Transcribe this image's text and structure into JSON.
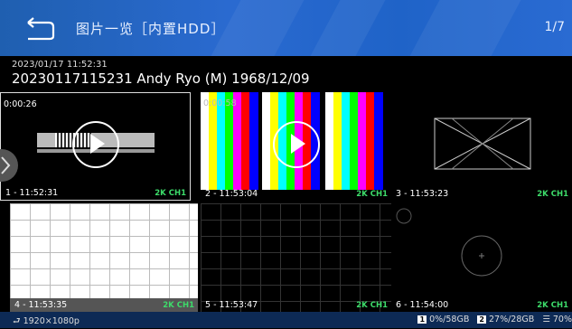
{
  "header": {
    "title": "图片一览［内置HDD］",
    "page_indicator": "1/7"
  },
  "record": {
    "datetime": "2023/01/17 11:52:31",
    "name": "20230117115231 Andy Ryo (M) 1968/12/09"
  },
  "thumbnails": [
    {
      "duration": "0:00:26",
      "caption": "1 - 11:52:31",
      "tag": "2K CH1"
    },
    {
      "duration": "0:00:58",
      "caption": "2 - 11:53:04",
      "tag": "2K CH1"
    },
    {
      "duration": "",
      "caption": "3 - 11:53:23",
      "tag": "2K CH1"
    },
    {
      "duration": "",
      "caption": "4 - 11:53:35",
      "tag": "2K CH1"
    },
    {
      "duration": "",
      "caption": "5 - 11:53:47",
      "tag": "2K CH1"
    },
    {
      "duration": "",
      "caption": "6 - 11:54:00",
      "tag": "2K CH1"
    }
  ],
  "status": {
    "resolution": "1920×1080p",
    "sd1_label": "1",
    "sd1_usage": "0%/58GB",
    "sd2_label": "2",
    "sd2_usage": "27%/28GB",
    "hdd_usage": "70%"
  },
  "colors": {
    "header_blue": "#1f5fb0",
    "status_bar": "#0d2a55",
    "tag_green": "#3ddc6a"
  }
}
